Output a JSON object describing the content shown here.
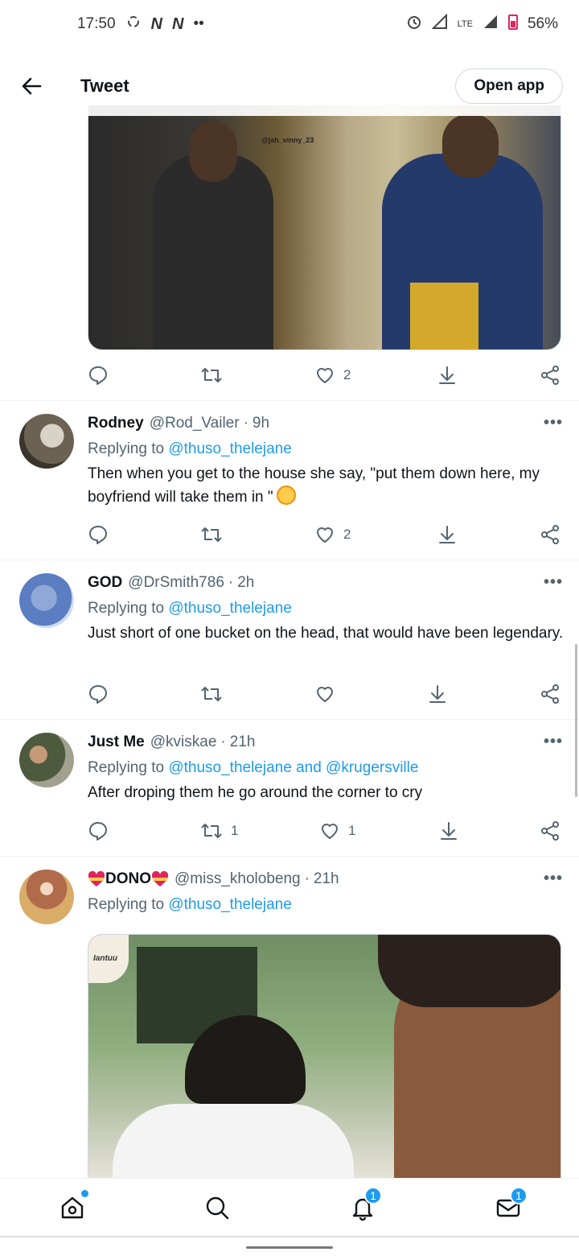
{
  "status_bar": {
    "time": "17:50",
    "battery": "56%",
    "network": "LTE"
  },
  "topbar": {
    "title": "Tweet",
    "open_app_label": "Open app"
  },
  "first_post_actions": {
    "likes": "2"
  },
  "replies": [
    {
      "name": "Rodney",
      "handle": "@Rod_Vailer",
      "time": "9h",
      "replying_prefix": "Replying to",
      "replying_to": "@thuso_thelejane",
      "text": "Then when you get to the house she say, \"put them down here, my boyfriend will take them in \"",
      "retweets": "",
      "likes": "2"
    },
    {
      "name": "GOD",
      "handle": "@DrSmith786",
      "time": "2h",
      "replying_prefix": "Replying to",
      "replying_to": "@thuso_thelejane",
      "text": "Just short of one bucket on the head, that would have been legendary.",
      "retweets": "",
      "likes": ""
    },
    {
      "name": "Just Me",
      "handle": "@kviskae",
      "time": "21h",
      "replying_prefix": "Replying to",
      "replying_to": "@thuso_thelejane and @krugersville",
      "text": "After droping them he go around the corner to cry",
      "retweets": "1",
      "likes": "1"
    },
    {
      "name": "DONO",
      "handle": "@miss_kholobeng",
      "time": "21h",
      "replying_prefix": "Replying to",
      "replying_to": "@thuso_thelejane"
    }
  ],
  "media": {
    "first_watermark": "@jah_vinny_23",
    "second_watermark": "Iantuu"
  },
  "bottom_nav": {
    "notifications_badge": "1",
    "messages_badge": "1"
  },
  "colors": {
    "accent": "#1d9bf0",
    "text": "#0f1419",
    "muted": "#536471"
  }
}
